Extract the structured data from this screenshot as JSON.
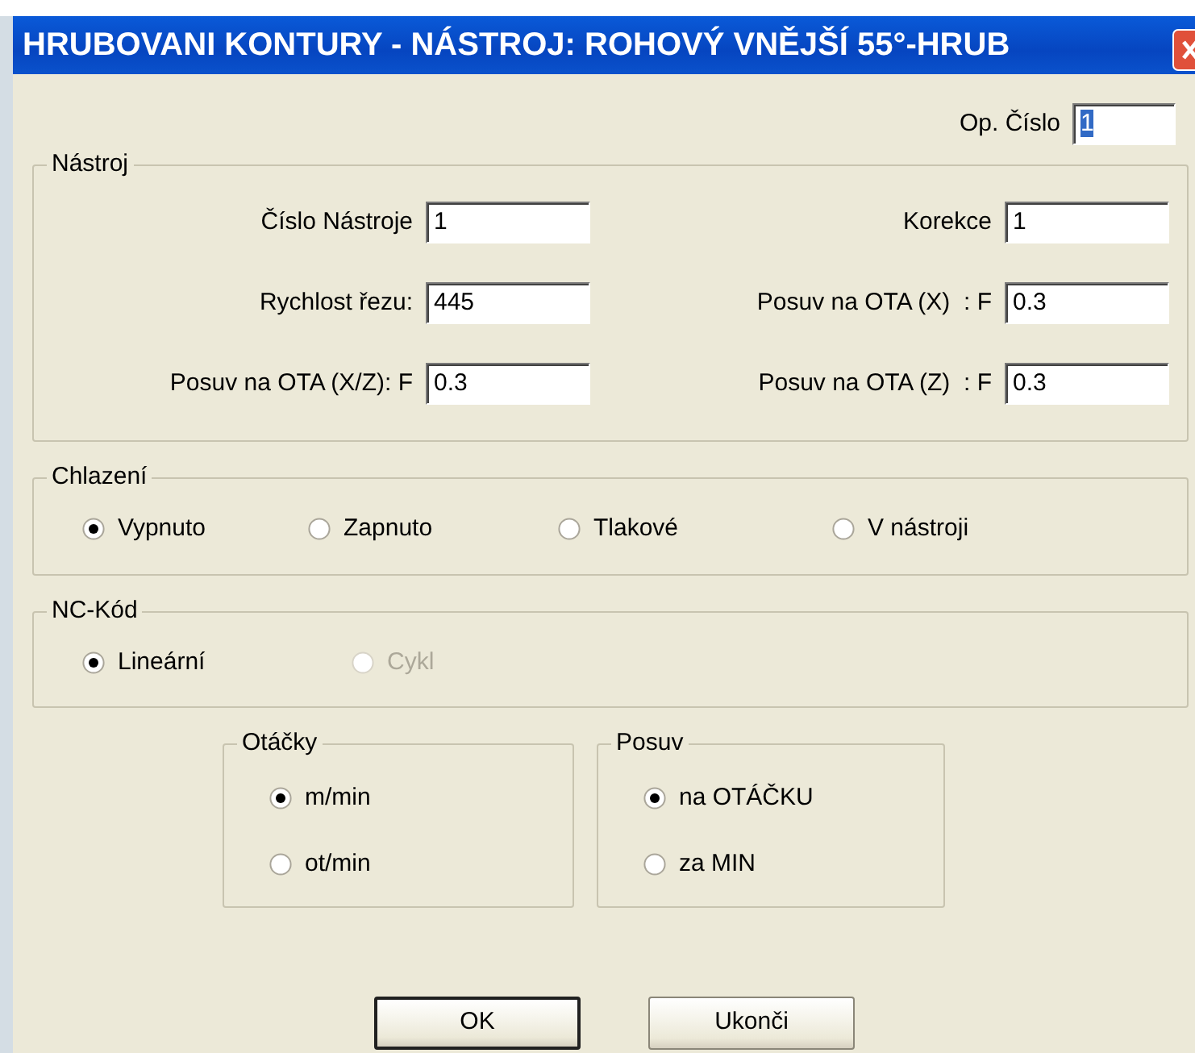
{
  "window": {
    "title": "HRUBOVANI KONTURY - NÁSTROJ: ROHOVÝ VNĚJŠÍ 55°-HRUB"
  },
  "op_cislo": {
    "label": "Op. Číslo",
    "value": "1",
    "value_selected": true
  },
  "nastroj": {
    "title": "Nástroj",
    "fields": [
      {
        "label": "Číslo Nástroje",
        "value": "1"
      },
      {
        "label": "Korekce",
        "value": "1"
      },
      {
        "label": "Rychlost řezu:",
        "value": "445"
      },
      {
        "label": "Posuv na OTA (X)  : F",
        "value": "0.3"
      },
      {
        "label": "Posuv na OTA (X/Z): F",
        "value": "0.3"
      },
      {
        "label": "Posuv na OTA (Z)  : F",
        "value": "0.3"
      }
    ]
  },
  "chlazeni": {
    "title": "Chlazení",
    "options": [
      {
        "label": "Vypnuto",
        "selected": true,
        "disabled": false
      },
      {
        "label": "Zapnuto",
        "selected": false,
        "disabled": false
      },
      {
        "label": "Tlakové",
        "selected": false,
        "disabled": false
      },
      {
        "label": "V nástroji",
        "selected": false,
        "disabled": false
      }
    ]
  },
  "nc_kod": {
    "title": "NC-Kód",
    "options": [
      {
        "label": "Lineární",
        "selected": true,
        "disabled": false
      },
      {
        "label": "Cykl",
        "selected": false,
        "disabled": true
      }
    ]
  },
  "otacky": {
    "title": "Otáčky",
    "options": [
      {
        "label": "m/min",
        "selected": true,
        "disabled": false
      },
      {
        "label": "ot/min",
        "selected": false,
        "disabled": false
      }
    ]
  },
  "posuv": {
    "title": "Posuv",
    "options": [
      {
        "label": "na OTÁČKU",
        "selected": true,
        "disabled": false
      },
      {
        "label": "za MIN",
        "selected": false,
        "disabled": false
      }
    ]
  },
  "buttons": [
    {
      "label": "OK",
      "default": true
    },
    {
      "label": "Ukonči",
      "default": false
    }
  ]
}
